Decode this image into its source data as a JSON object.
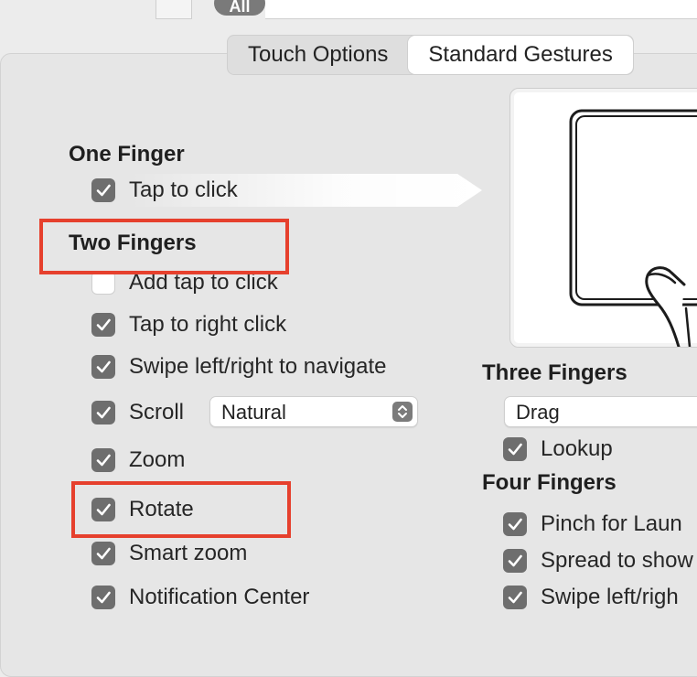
{
  "top": {
    "filter_label": "All"
  },
  "tabs": [
    {
      "label": "Touch Options"
    },
    {
      "label": "Standard Gestures"
    }
  ],
  "one_finger": {
    "header": "One Finger",
    "items": [
      {
        "label": "Tap to click",
        "checked": true
      }
    ]
  },
  "two_fingers": {
    "header": "Two Fingers",
    "items": [
      {
        "label": "Add tap to click",
        "checked": false
      },
      {
        "label": "Tap to right click",
        "checked": true
      },
      {
        "label": "Swipe left/right to navigate",
        "checked": true
      },
      {
        "label": "Scroll",
        "checked": true
      },
      {
        "label": "Zoom",
        "checked": true
      },
      {
        "label": "Rotate",
        "checked": true
      },
      {
        "label": "Smart zoom",
        "checked": true
      },
      {
        "label": "Notification Center",
        "checked": true
      }
    ],
    "scroll_direction": "Natural"
  },
  "three_fingers": {
    "header": "Three Fingers",
    "mode": "Drag",
    "items": [
      {
        "label": "Lookup",
        "checked": true
      }
    ]
  },
  "four_fingers": {
    "header": "Four Fingers",
    "items": [
      {
        "label": "Pinch for Laun",
        "checked": true
      },
      {
        "label": "Spread to show",
        "checked": true
      },
      {
        "label": "Swipe left/righ",
        "checked": true
      }
    ]
  },
  "colors": {
    "highlight": "#e6402d",
    "checkbox": "#6e6e6e"
  }
}
